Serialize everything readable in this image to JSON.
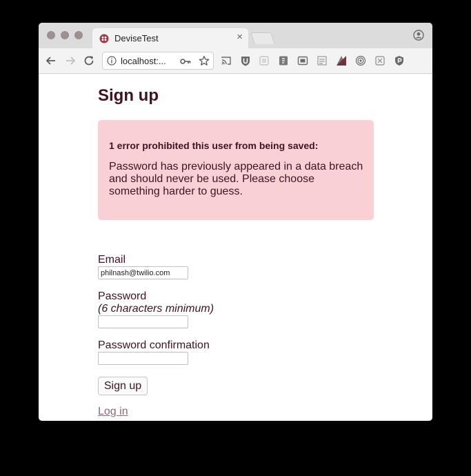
{
  "browser": {
    "tab_title": "DeviseTest",
    "tab_close": "×",
    "address": "localhost:...",
    "extensions": [
      "cast-icon",
      "ublock-icon",
      "extension-icon",
      "bookmarklet-icon",
      "screenshot-icon",
      "extension-icon",
      "palette-icon",
      "fingerprint-icon",
      "extension-icon",
      "shield-icon"
    ]
  },
  "page": {
    "title": "Sign up",
    "error": {
      "heading": "1 error prohibited this user from being saved:",
      "message": "Password has previously appeared in a data breach and should never be used. Please choose something harder to guess."
    },
    "email": {
      "label": "Email",
      "value": "philnash@twilio.com"
    },
    "password": {
      "label": "Password",
      "hint": "(6 characters minimum)",
      "value": ""
    },
    "password_confirmation": {
      "label": "Password confirmation",
      "value": ""
    },
    "submit_label": "Sign up",
    "login_link": "Log in"
  },
  "colors": {
    "text": "#3d1420",
    "error_bg": "#f8d0d6",
    "link": "#8a6a72"
  }
}
